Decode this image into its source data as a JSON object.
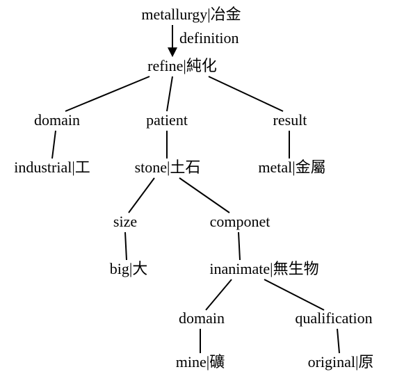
{
  "nodes": {
    "metallurgy": "metallurgy|冶金",
    "definition": "definition",
    "refine": "refine|純化",
    "domain1": "domain",
    "patient": "patient",
    "result": "result",
    "industrial": "industrial|工",
    "stone": "stone|土石",
    "metal": "metal|金屬",
    "size": "size",
    "componet": "componet",
    "big": "big|大",
    "inanimate": "inanimate|無生物",
    "domain2": "domain",
    "qualification": "qualification",
    "mine": "mine|礦",
    "original": "original|原"
  }
}
